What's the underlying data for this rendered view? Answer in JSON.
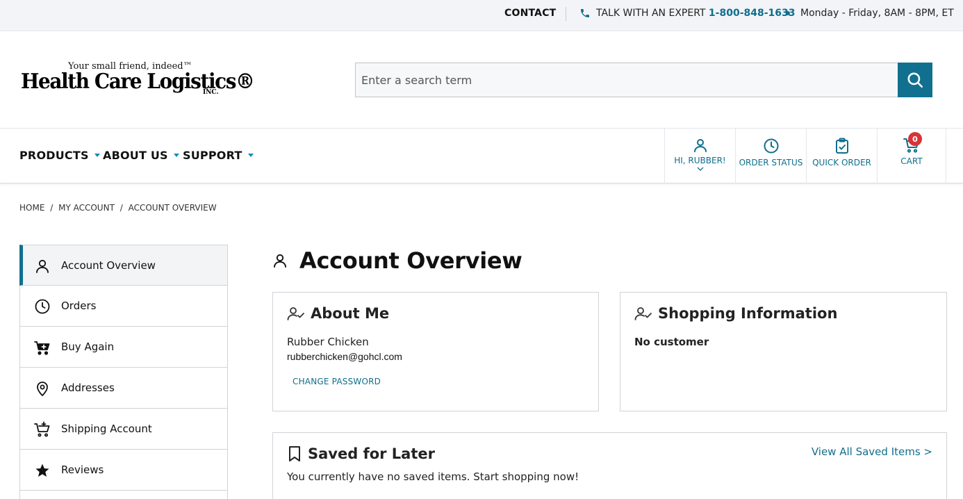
{
  "topbar": {
    "contact": "CONTACT",
    "talk_label": "TALK WITH AN EXPERT ",
    "phone": "1-800-848-1633",
    "hours": "Monday - Friday, 8AM - 8PM, ET"
  },
  "logo": {
    "tagline": "Your small friend, indeed™",
    "brand": "Health Care Logistics®",
    "inc": "INC."
  },
  "search": {
    "placeholder": "Enter a search term"
  },
  "nav": {
    "menu": [
      {
        "label": "PRODUCTS"
      },
      {
        "label": "ABOUT US"
      },
      {
        "label": "SUPPORT"
      }
    ],
    "account_label": "HI, RUBBER!",
    "order_status_label": "ORDER STATUS",
    "quick_order_label": "QUICK ORDER",
    "cart_label": "CART",
    "cart_count": "0"
  },
  "breadcrumb": [
    "HOME",
    "/",
    "MY ACCOUNT",
    "/",
    "ACCOUNT OVERVIEW"
  ],
  "sidebar": {
    "items": [
      {
        "label": "Account Overview",
        "icon": "user-icon"
      },
      {
        "label": "Orders",
        "icon": "clock-icon"
      },
      {
        "label": "Buy Again",
        "icon": "cart-plus-icon"
      },
      {
        "label": "Addresses",
        "icon": "map-pin-icon"
      },
      {
        "label": "Shipping Account",
        "icon": "shipping-cart-icon"
      },
      {
        "label": "Reviews",
        "icon": "star-icon"
      }
    ]
  },
  "main": {
    "title": "Account Overview",
    "about": {
      "title": "About Me",
      "name": "Rubber Chicken",
      "email": "rubberchicken@gohcl.com",
      "change_password": "CHANGE PASSWORD"
    },
    "shopping": {
      "title": "Shopping Information",
      "status": "No customer"
    },
    "saved": {
      "title": "Saved for Later",
      "view_all": "View All Saved Items >",
      "empty": "You currently have no saved items. Start shopping now!"
    }
  },
  "colors": {
    "accent": "#11708f",
    "link": "#0f6e8c",
    "badge": "#d73338",
    "topbar_bg": "#f2f4f8"
  }
}
